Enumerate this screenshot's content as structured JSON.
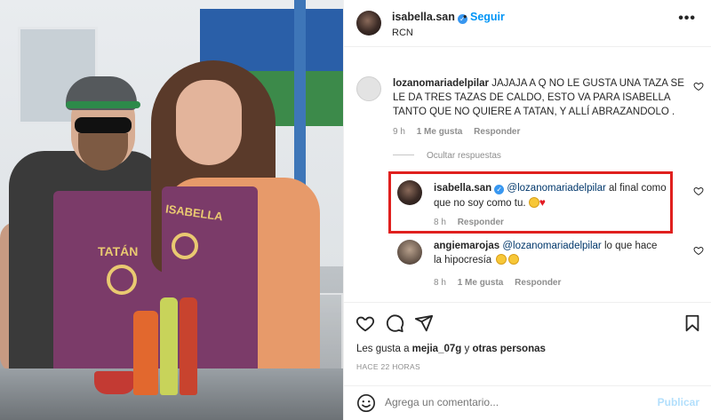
{
  "photo": {
    "apron_label_left": "TATÁN",
    "apron_label_right": "ISABELLA"
  },
  "header": {
    "username": "isabella.san",
    "follow_label": "Seguir",
    "dot": "•",
    "subtitle": "RCN",
    "more_label": "•••"
  },
  "comments": [
    {
      "username": "lozanomariadelpilar",
      "text": "JAJAJA A Q NO LE GUSTA UNA TAZA SE LE DA TRES TAZAS DE CALDO, ESTO VA PARA ISABELLA TANTO QUE NO QUIERE A TATAN, Y ALLÍ ABRAZANDOLO .",
      "time": "9 h",
      "likes": "1 Me gusta",
      "reply": "Responder"
    }
  ],
  "hide_replies": "Ocultar respuestas",
  "replies": [
    {
      "username": "isabella.san",
      "mention": "@lozanomariadelpilar",
      "text": "al final como que no soy como tu.",
      "time": "8 h",
      "reply": "Responder"
    },
    {
      "username": "angiemarojas",
      "mention": "@lozanomariadelpilar",
      "text": "lo que hace la hipocresía",
      "time": "8 h",
      "likes": "1 Me gusta",
      "reply": "Responder"
    }
  ],
  "footer": {
    "likes_prefix": "Les gusta a",
    "likes_user": "mejia_07g",
    "likes_connector": "y",
    "likes_others": "otras personas",
    "timestamp": "HACE 22 HORAS",
    "comment_placeholder": "Agrega un comentario...",
    "publish_label": "Publicar"
  },
  "colors": {
    "link_blue": "#0095f6",
    "highlight_red": "#e0201e",
    "mention_blue": "#00376b",
    "muted": "#8e8e8e"
  },
  "icons": [
    "verified-badge-icon",
    "more-icon",
    "heart-icon",
    "comment-icon",
    "share-icon",
    "bookmark-icon",
    "emoji-icon"
  ]
}
